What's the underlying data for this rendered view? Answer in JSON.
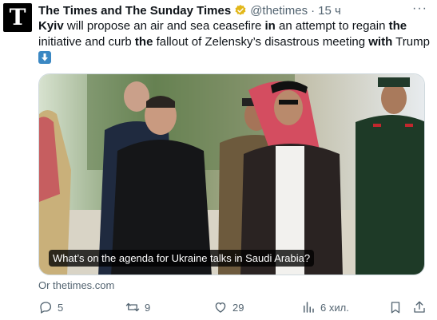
{
  "post": {
    "avatar_letter": "T",
    "author_name": "The Times and The Sunday Times",
    "handle": "@thetimes",
    "separator": "·",
    "timestamp": "15 ч",
    "more_label": "···",
    "text_parts": {
      "p1": "Kyiv",
      "p2": " will propose an air and sea ceasefire ",
      "p3": "in",
      "p4": " an attempt to regain ",
      "p5": "the",
      "p6": " initiative and curb ",
      "p7": "the",
      "p8": " fallout of Zelensky’s disastrous meeting ",
      "p9": "with",
      "p10": " Trump"
    },
    "emoji": "down-arrow-icon"
  },
  "media": {
    "caption": "What’s on the agenda for Ukraine talks in Saudi Arabia?"
  },
  "link": {
    "domain": "Or thetimes.com"
  },
  "actions": {
    "replies": "5",
    "reposts": "9",
    "likes": "29",
    "views": "6 хил."
  },
  "colors": {
    "verified_badge": "#e2b719",
    "emoji_bg": "#3b88c3",
    "text_secondary": "#536471"
  }
}
